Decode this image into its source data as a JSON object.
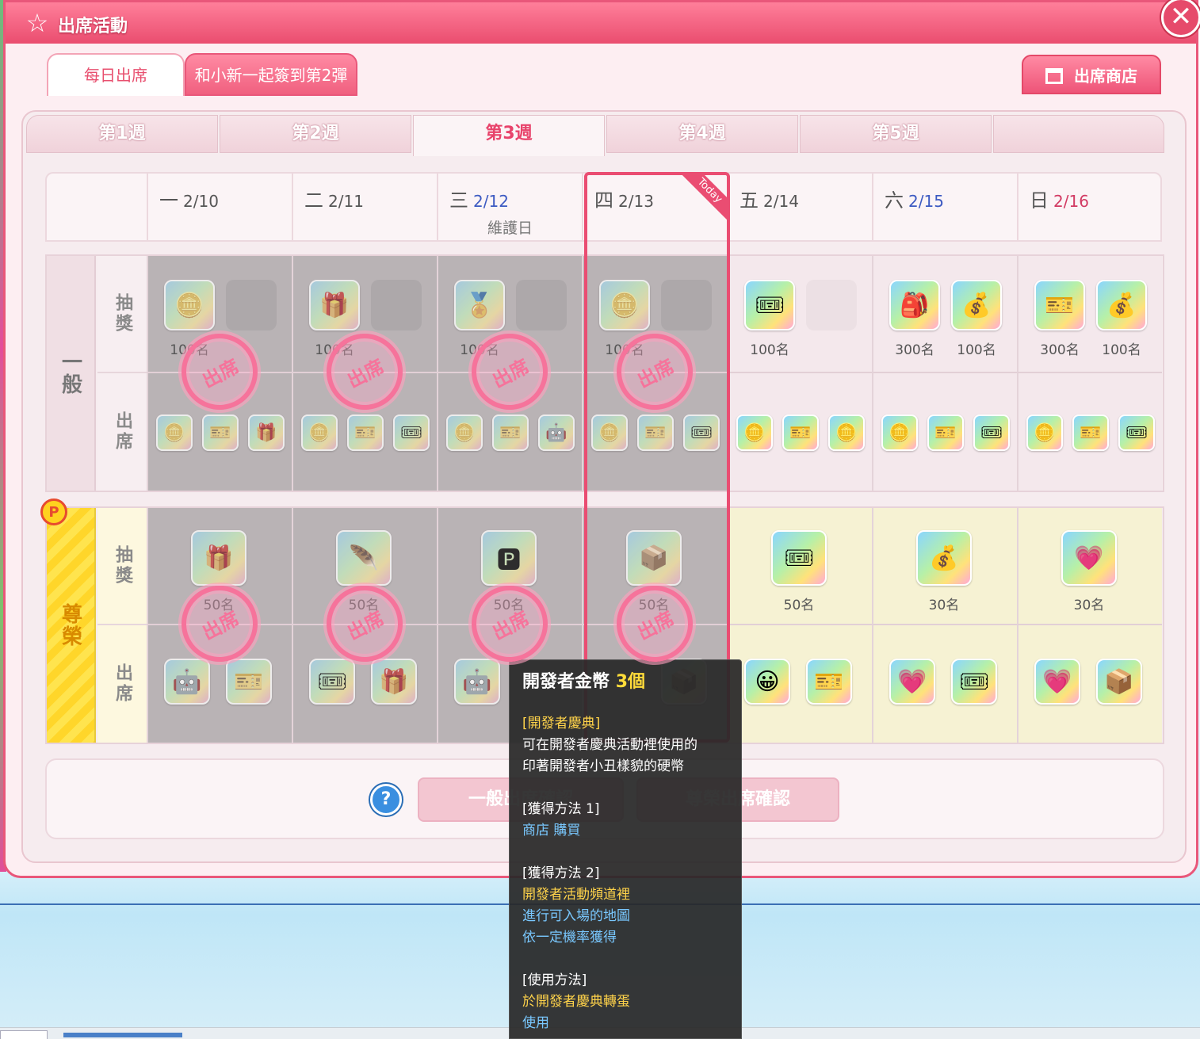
{
  "window": {
    "title": "出席活動",
    "tabs": [
      {
        "label": "每日出席",
        "active": true
      },
      {
        "label": "和小新一起簽到第2彈",
        "active": false
      }
    ],
    "shop_label": "出席商店",
    "close_label": "✕"
  },
  "weeks": [
    {
      "label": "第1週",
      "active": false
    },
    {
      "label": "第2週",
      "active": false
    },
    {
      "label": "第3週",
      "active": true
    },
    {
      "label": "第4週",
      "active": false
    },
    {
      "label": "第5週",
      "active": false
    },
    {
      "label": "",
      "active": false
    }
  ],
  "days": [
    {
      "weekday": "一",
      "date": "2/10",
      "color": "normal",
      "note": ""
    },
    {
      "weekday": "二",
      "date": "2/11",
      "color": "normal",
      "note": ""
    },
    {
      "weekday": "三",
      "date": "2/12",
      "color": "blue",
      "note": "維護日"
    },
    {
      "weekday": "四",
      "date": "2/13",
      "color": "normal",
      "note": ""
    },
    {
      "weekday": "五",
      "date": "2/14",
      "color": "normal",
      "note": ""
    },
    {
      "weekday": "六",
      "date": "2/15",
      "color": "blue",
      "note": ""
    },
    {
      "weekday": "日",
      "date": "2/16",
      "color": "red",
      "note": ""
    }
  ],
  "today_label": "Today",
  "sections": {
    "normal": {
      "label": "一般",
      "lottery_label": "抽獎",
      "attend_label": "出席"
    },
    "premium": {
      "label": "尊榮",
      "lottery_label": "抽獎",
      "attend_label": "出席",
      "badge": "P"
    }
  },
  "normal_lottery": [
    {
      "items": [
        "🪙",
        ""
      ],
      "qty": [
        "100名",
        ""
      ]
    },
    {
      "items": [
        "🎁",
        ""
      ],
      "qty": [
        "100名",
        ""
      ]
    },
    {
      "items": [
        "🏅",
        ""
      ],
      "qty": [
        "100名",
        ""
      ]
    },
    {
      "items": [
        "🪙",
        ""
      ],
      "qty": [
        "100名",
        ""
      ]
    },
    {
      "items": [
        "🎟",
        ""
      ],
      "qty": [
        "100名",
        ""
      ]
    },
    {
      "items": [
        "🎒",
        "💰"
      ],
      "qty": [
        "300名",
        "100名"
      ]
    },
    {
      "items": [
        "🎫",
        "💰"
      ],
      "qty": [
        "300名",
        "100名"
      ]
    }
  ],
  "normal_attend": [
    [
      "🪙",
      "🎫",
      "🎁"
    ],
    [
      "🪙",
      "🎫",
      "🎟"
    ],
    [
      "🪙",
      "🎫",
      "🤖"
    ],
    [
      "🪙",
      "🎫",
      "🎟"
    ],
    [
      "🪙",
      "🎫",
      "🪙"
    ],
    [
      "🪙",
      "🎫",
      "🎟"
    ],
    [
      "🪙",
      "🎫",
      "🎟"
    ]
  ],
  "premium_lottery": [
    {
      "item": "🎁",
      "qty": "50名"
    },
    {
      "item": "🪶",
      "qty": "50名"
    },
    {
      "item": "🅿",
      "qty": "50名"
    },
    {
      "item": "📦",
      "qty": "50名"
    },
    {
      "item": "🎟",
      "qty": "50名"
    },
    {
      "item": "💰",
      "qty": "30名"
    },
    {
      "item": "💗",
      "qty": "30名"
    }
  ],
  "premium_attend": [
    [
      "🤖",
      "🎫"
    ],
    [
      "🎟",
      "🎁"
    ],
    [
      "🤖",
      ""
    ],
    [
      "",
      "📦"
    ],
    [
      "😀",
      "🎫"
    ],
    [
      "💗",
      "🎟"
    ],
    [
      "💗",
      "📦"
    ]
  ],
  "stamp_label": "出席",
  "bottom": {
    "help": "?",
    "normal_confirm": "一般出席確認",
    "premium_confirm": "尊榮出席確認"
  },
  "tooltip": {
    "title": "開發者金幣",
    "count": "3個",
    "lines": [
      {
        "text": "[開發者慶典]",
        "color": "y"
      },
      {
        "text": "可在開發者慶典活動裡使用的",
        "color": ""
      },
      {
        "text": "印著開發者小丑樣貌的硬幣",
        "color": ""
      },
      {
        "text": "",
        "color": "gap"
      },
      {
        "text": "[獲得方法 1]",
        "color": ""
      },
      {
        "text": "商店 購買",
        "color": "b"
      },
      {
        "text": "",
        "color": "gap"
      },
      {
        "text": "[獲得方法 2]",
        "color": ""
      },
      {
        "text": "開發者活動頻道裡",
        "color": "y"
      },
      {
        "text": "進行可入場的地圖",
        "color": "b"
      },
      {
        "text": "依一定機率獲得",
        "color": "b"
      },
      {
        "text": "",
        "color": "gap"
      },
      {
        "text": "[使用方法]",
        "color": ""
      },
      {
        "text": "於開發者慶典轉蛋",
        "color": "y"
      },
      {
        "text": "使用",
        "color": "b"
      }
    ]
  }
}
